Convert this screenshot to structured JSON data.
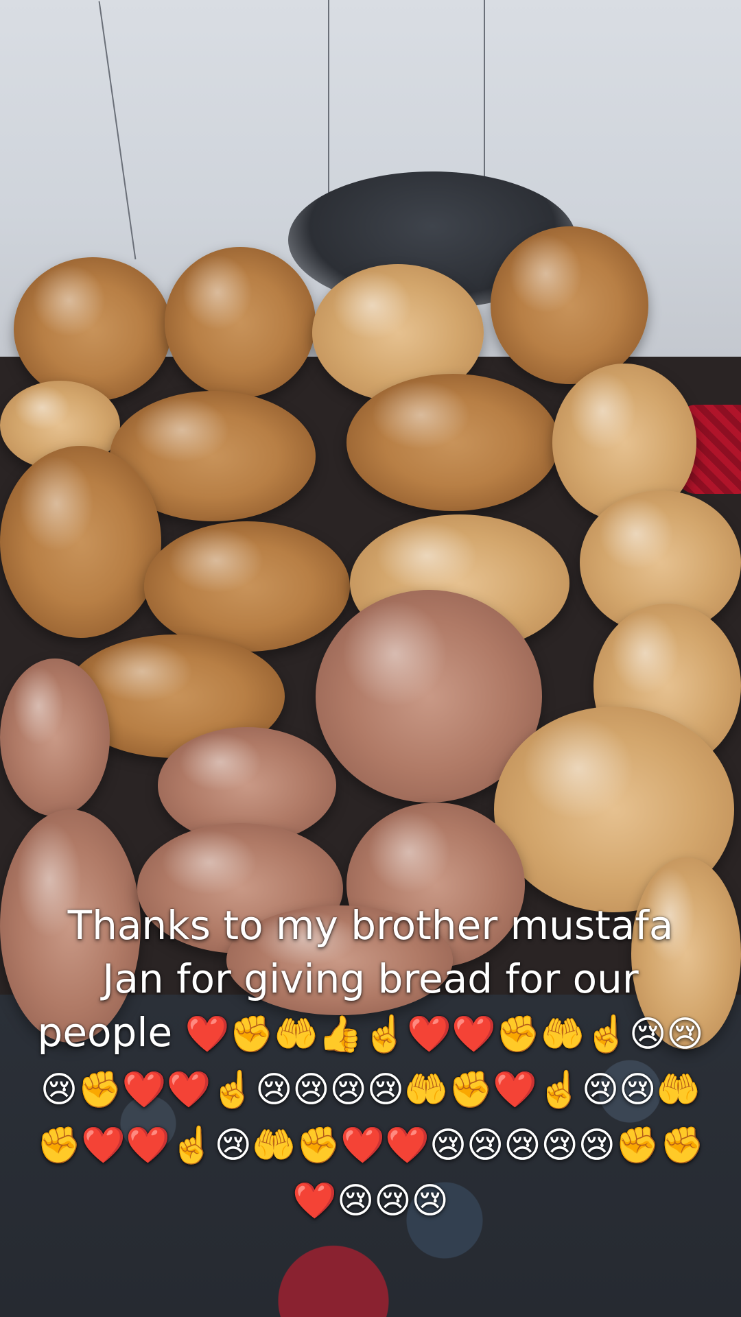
{
  "caption": {
    "text": "Thanks to my brother mustafa Jan for giving bread for our people",
    "emojis": "❤️✊🤲👍☝️❤️❤️✊🤲☝️😢😢😢✊❤️❤️☝️😢😢😢😢🤲✊❤️☝️😢😢🤲✊❤️❤️☝️😢🤲✊❤️❤️😢😢😢😢😢✊✊❤️😢😢😢"
  }
}
